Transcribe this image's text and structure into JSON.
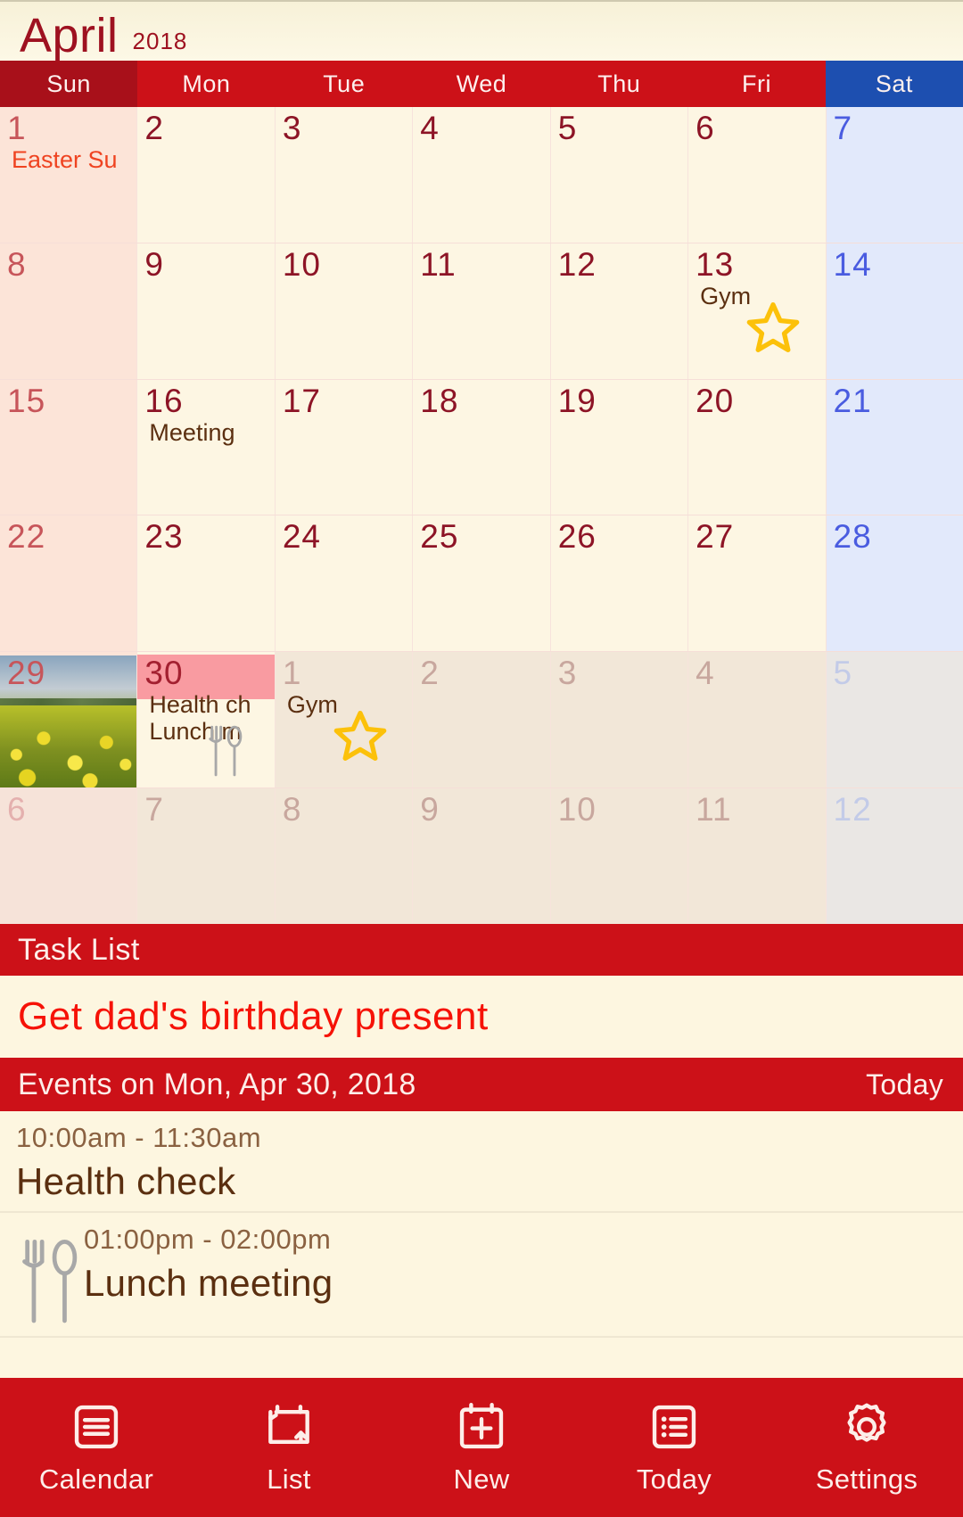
{
  "header": {
    "month": "April",
    "year": "2018"
  },
  "weekdays": [
    {
      "label": "Sun",
      "kind": "sun"
    },
    {
      "label": "Mon",
      "kind": "wd"
    },
    {
      "label": "Tue",
      "kind": "wd"
    },
    {
      "label": "Wed",
      "kind": "wd"
    },
    {
      "label": "Thu",
      "kind": "wd"
    },
    {
      "label": "Fri",
      "kind": "wd"
    },
    {
      "label": "Sat",
      "kind": "sat"
    }
  ],
  "weeks": [
    [
      {
        "num": "1",
        "col": "sun",
        "event": "Easter Su",
        "holiday": true
      },
      {
        "num": "2",
        "col": "wd"
      },
      {
        "num": "3",
        "col": "wd"
      },
      {
        "num": "4",
        "col": "wd"
      },
      {
        "num": "5",
        "col": "wd"
      },
      {
        "num": "6",
        "col": "wd"
      },
      {
        "num": "7",
        "col": "sat"
      }
    ],
    [
      {
        "num": "8",
        "col": "sun"
      },
      {
        "num": "9",
        "col": "wd"
      },
      {
        "num": "10",
        "col": "wd"
      },
      {
        "num": "11",
        "col": "wd"
      },
      {
        "num": "12",
        "col": "wd"
      },
      {
        "num": "13",
        "col": "wd",
        "event": "Gym",
        "star": true
      },
      {
        "num": "14",
        "col": "sat"
      }
    ],
    [
      {
        "num": "15",
        "col": "sun"
      },
      {
        "num": "16",
        "col": "wd",
        "event": "Meeting"
      },
      {
        "num": "17",
        "col": "wd"
      },
      {
        "num": "18",
        "col": "wd"
      },
      {
        "num": "19",
        "col": "wd"
      },
      {
        "num": "20",
        "col": "wd"
      },
      {
        "num": "21",
        "col": "sat"
      }
    ],
    [
      {
        "num": "22",
        "col": "sun"
      },
      {
        "num": "23",
        "col": "wd"
      },
      {
        "num": "24",
        "col": "wd"
      },
      {
        "num": "25",
        "col": "wd"
      },
      {
        "num": "26",
        "col": "wd"
      },
      {
        "num": "27",
        "col": "wd"
      },
      {
        "num": "28",
        "col": "sat"
      }
    ],
    [
      {
        "num": "29",
        "col": "sun",
        "photo": true
      },
      {
        "num": "30",
        "col": "wd",
        "today": true,
        "event": "Health ch",
        "event2": "Lunch m",
        "cutlery": true
      },
      {
        "num": "1",
        "col": "wd",
        "other": true,
        "event": "Gym",
        "star": true
      },
      {
        "num": "2",
        "col": "wd",
        "other": true
      },
      {
        "num": "3",
        "col": "wd",
        "other": true
      },
      {
        "num": "4",
        "col": "wd",
        "other": true
      },
      {
        "num": "5",
        "col": "sat",
        "other": true
      }
    ],
    [
      {
        "num": "6",
        "col": "sun",
        "other": true
      },
      {
        "num": "7",
        "col": "wd",
        "other": true
      },
      {
        "num": "8",
        "col": "wd",
        "other": true
      },
      {
        "num": "9",
        "col": "wd",
        "other": true
      },
      {
        "num": "10",
        "col": "wd",
        "other": true
      },
      {
        "num": "11",
        "col": "wd",
        "other": true
      },
      {
        "num": "12",
        "col": "sat",
        "other": true
      }
    ]
  ],
  "task_section": {
    "title": "Task List",
    "items": [
      {
        "text": "Get dad's birthday present"
      }
    ]
  },
  "events_section": {
    "title": "Events on Mon, Apr 30, 2018",
    "today_button": "Today",
    "events": [
      {
        "time": "10:00am - 11:30am",
        "title": "Health check",
        "icon": ""
      },
      {
        "time": "01:00pm - 02:00pm",
        "title": "Lunch meeting",
        "icon": "cutlery-icon"
      }
    ]
  },
  "bottom_nav": [
    {
      "label": "Calendar",
      "icon": "calendar-icon"
    },
    {
      "label": "List",
      "icon": "list-refresh-icon"
    },
    {
      "label": "New",
      "icon": "calendar-plus-icon"
    },
    {
      "label": "Today",
      "icon": "bullet-list-icon"
    },
    {
      "label": "Settings",
      "icon": "gear-icon"
    }
  ],
  "colors": {
    "accent_red": "#cc1118",
    "sun_red": "#a8101a",
    "sat_blue": "#1d4fb0",
    "paper": "#fdf6e0",
    "today_pink": "#f99ba1",
    "star_gold": "#fcc10a",
    "task_red": "#f61207"
  }
}
